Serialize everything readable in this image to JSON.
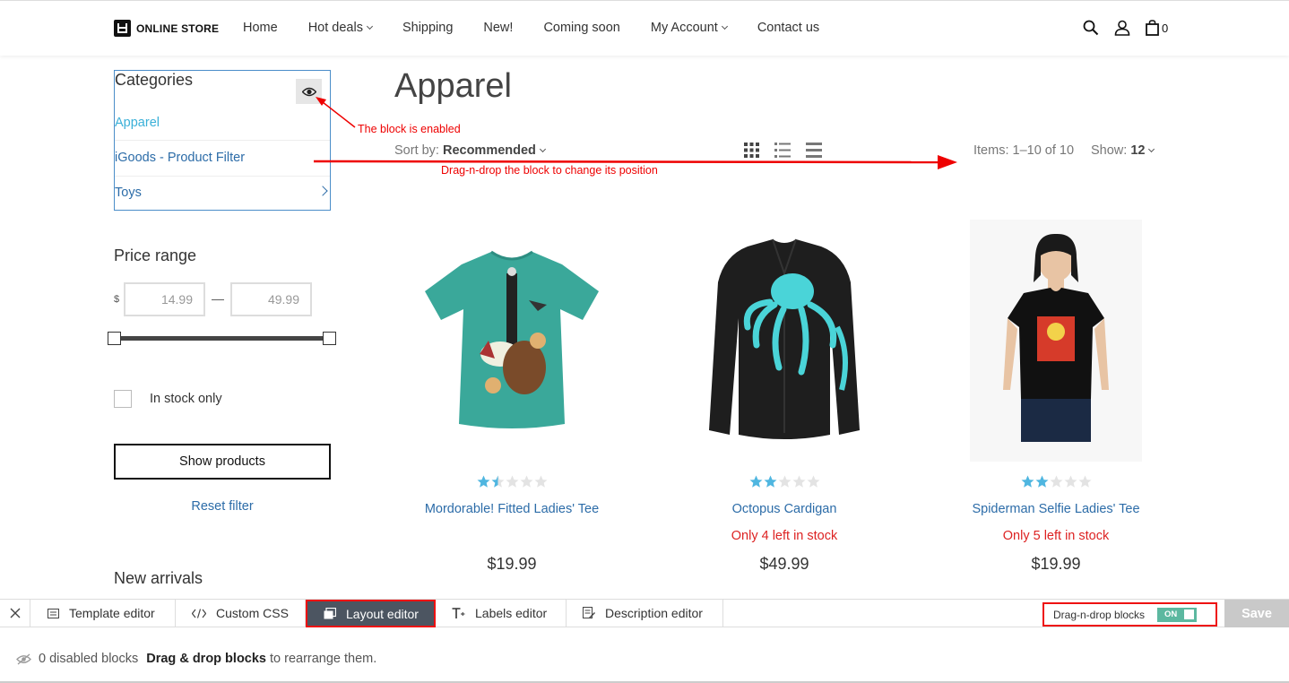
{
  "header": {
    "logo_text": "ONLINE STORE",
    "nav": [
      {
        "label": "Home",
        "dropdown": false
      },
      {
        "label": "Hot deals",
        "dropdown": true
      },
      {
        "label": "Shipping",
        "dropdown": false
      },
      {
        "label": "New!",
        "dropdown": false
      },
      {
        "label": "Coming soon",
        "dropdown": false
      },
      {
        "label": "My Account",
        "dropdown": true
      },
      {
        "label": "Contact us",
        "dropdown": false
      }
    ],
    "cart_count": "0"
  },
  "sidebar": {
    "categories_title": "Categories",
    "categories": [
      {
        "label": "Apparel",
        "active": true
      },
      {
        "label": "iGoods - Product Filter",
        "active": false
      },
      {
        "label": "Toys",
        "active": false
      }
    ],
    "price_title": "Price range",
    "currency": "$",
    "price_min": "14.99",
    "price_max": "49.99",
    "price_dash": "—",
    "instock_label": "In stock only",
    "show_button": "Show products",
    "reset_link": "Reset filter",
    "new_arrivals": "New arrivals"
  },
  "main": {
    "title": "Apparel",
    "sort_label": "Sort by:",
    "sort_value": "Recommended",
    "items_count": "Items: 1–10 of 10",
    "show_label": "Show:",
    "show_value": "12",
    "products": [
      {
        "name": "Mordorable! Fitted Ladies' Tee",
        "stock": "",
        "price": "$19.99",
        "rating": 1.5,
        "shirt_color": "#3aa89a"
      },
      {
        "name": "Octopus Cardigan",
        "stock": "Only 4 left in stock",
        "price": "$49.99",
        "rating": 2,
        "shirt_color": "#1a1a1a"
      },
      {
        "name": "Spiderman Selfie Ladies' Tee",
        "stock": "Only 5 left in stock",
        "price": "$19.99",
        "rating": 2,
        "shirt_color": "#111111"
      }
    ]
  },
  "annotations": {
    "enabled_note": "The block is enabled",
    "dnd_note": "Drag-n-drop the block to change its position"
  },
  "editor": {
    "tabs": [
      {
        "label": "Template editor",
        "icon": "template-icon"
      },
      {
        "label": "Custom CSS",
        "icon": "code-icon"
      },
      {
        "label": "Layout editor",
        "icon": "layout-icon"
      },
      {
        "label": "Labels editor",
        "icon": "text-icon"
      },
      {
        "label": "Description editor",
        "icon": "description-icon"
      }
    ],
    "active_tab": "Layout editor",
    "dnd_label": "Drag-n-drop blocks",
    "toggle_label": "ON",
    "save_label": "Save",
    "disabled_blocks": "0 disabled blocks",
    "dnd_hint_bold": "Drag & drop blocks",
    "dnd_hint_rest": "to rearrange them."
  },
  "colors": {
    "link": "#2c6ca8",
    "active_link": "#3ab0d8",
    "stock_warning": "#dd2222",
    "annotation": "#ee0000",
    "toggle_on": "#5cb8a0",
    "active_tab_bg": "#4c5561",
    "star_filled": "#4fb6e0"
  }
}
